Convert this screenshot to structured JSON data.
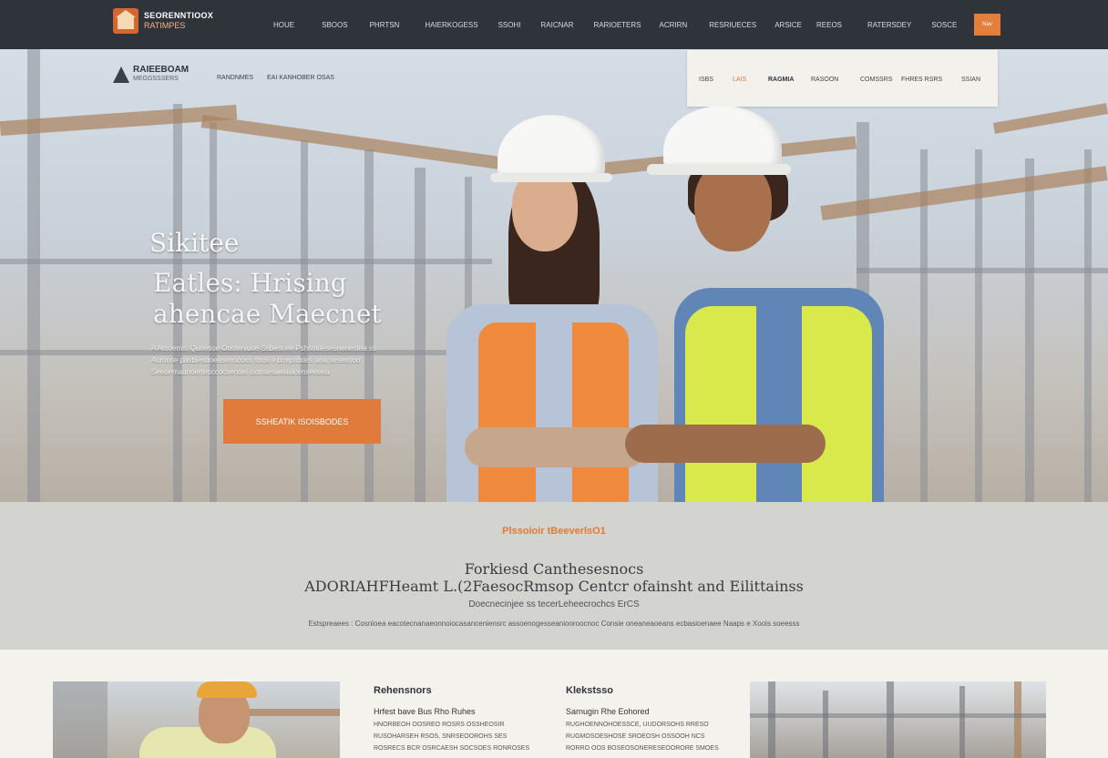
{
  "topnav": {
    "brand_name": "SEORENNTIOOX",
    "brand_sub": "RATIMPES",
    "items": [
      "HOUE",
      "SBOOS",
      "PHRTSN",
      "HAIERKOGESS",
      "SSOHI",
      "RAICNAR",
      "RARIOETERS",
      "ACRIRN",
      "RESRIUECES",
      "ARSICE",
      "REEOS",
      "RATERSDEY",
      "SOSCE"
    ],
    "cta_label": "Nav"
  },
  "hero": {
    "sub_logo_name": "RAIEEBOAM",
    "sub_logo_sub": "MEGGSSSERS",
    "sub_links": [
      "RANDNMES",
      "EAI KANHOBER OSAS"
    ],
    "white_nav": [
      "ISBS",
      "LAIS",
      "RAGMIA",
      "RASOON",
      "COMSSRS",
      "FHRES RSRS",
      "SSIAN"
    ],
    "kicker": "Sikitee",
    "title_line1": "Eatles: Hrising",
    "title_line2": "ahencae Maecnet",
    "desc_lines": [
      "A Arsoems: Qunesoe Oosteniuoe Ssbest ee Pshsoidesesnenestea ss",
      "Aomnse pasbiesdoeasensooss sbos e bcepsbdes ana sesesnoo",
      "Seeoemaanoerteoccocsenoei isonsesiaeaiacenseeoea"
    ],
    "cta_label": "SSHEATIK ISOISBODES"
  },
  "intro": {
    "kicker": "Plssoioir tBeeverlsO1",
    "title_line1": "Forkiesd Canthesesnocs",
    "title_line2": "ADORIAHFHeamt L.(2FaesocRmsop Centcr ofainsht and Eilittainss",
    "sub": "Doecnecinjee ss tecerLeheecrochcs ErCS",
    "text": "Estspreaees : Cosnioea eacotecnanaeonnoiocasanceniensrc assoenogesseaniooroocnoc Consie oneaneaoeans ecbasioenaee Naaps e Xoois soeesss"
  },
  "bottom": {
    "col1": {
      "title": "Rehensnors",
      "sub": "Hrfest bave Bus Rho Ruhes",
      "lines": [
        "HNORBEOH OOSREO ROSRS OSSHEOSIR",
        "RUSOHARSEH RSOS, SNRSEOOROHS SES",
        "ROSRECS BCR OSRCAESH SOCSOES RONROSES"
      ]
    },
    "col2": {
      "title": "Klekstsso",
      "sub": "Sarnugin Rhe Eohored",
      "lines": [
        "RUGHOENNOHOESSCE, UUDORSOHS RRESO",
        "RUGMOSOESHOSE SROEOSH OSSOOH NCS",
        "RORRO OOS BOSEOSONERESEOORORE SMOES"
      ]
    }
  },
  "colors": {
    "nav_bg": "#2f343b",
    "accent": "#e07b3c",
    "intro_bg": "#d3d3cf",
    "page_bg": "#f4f2ed"
  }
}
